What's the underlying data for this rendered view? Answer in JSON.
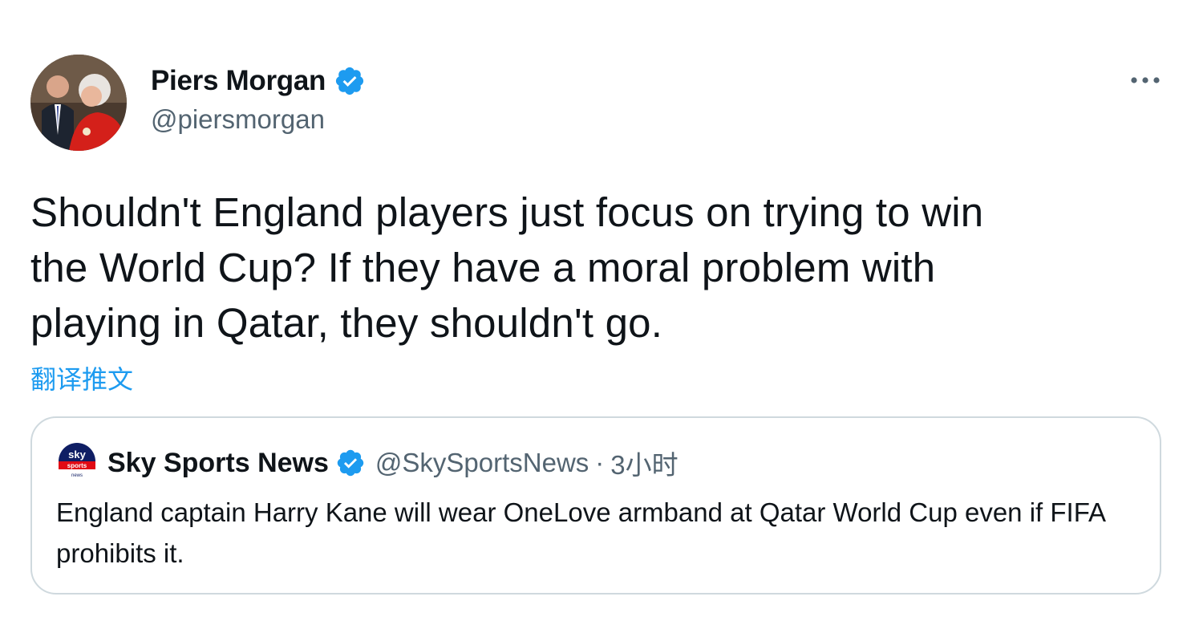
{
  "author": {
    "name": "Piers Morgan",
    "handle": "@piersmorgan",
    "verified": true
  },
  "more_icon": "more-dots-icon",
  "tweet": {
    "text": "Shouldn't England players just focus on trying to win\nthe World Cup? If they have a moral problem with\nplaying in Qatar, they shouldn't go.",
    "translate_label": "翻译推文"
  },
  "quoted_tweet": {
    "author_name": "Sky Sports News",
    "author_handle": "@SkySportsNews",
    "separator": "·",
    "time": "3小时",
    "verified": true,
    "text": "England captain Harry Kane will wear OneLove armband at Qatar World Cup even if FIFA prohibits it.",
    "logo": {
      "line1": "sky",
      "line2": "sports",
      "line3": "news"
    }
  },
  "colors": {
    "text_primary": "#0f1419",
    "text_secondary": "#536471",
    "accent": "#1d9bf0",
    "border": "#cfd9de",
    "sky_red": "#e10a14",
    "sky_blue": "#0f1e64"
  }
}
